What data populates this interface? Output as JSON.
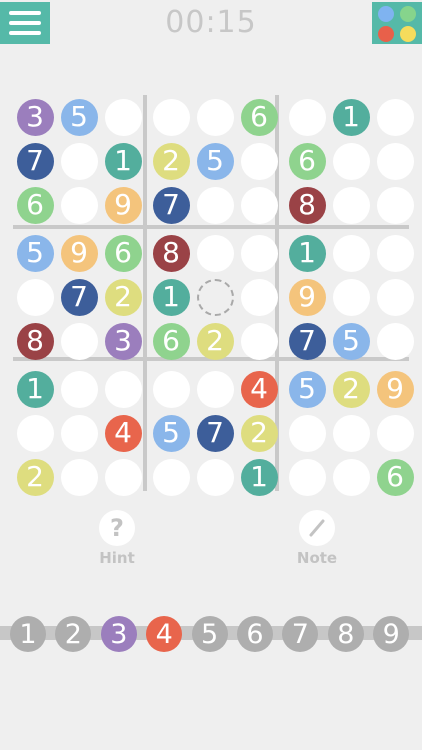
{
  "header": {
    "timer": "00:15",
    "menu_icon": "hamburger-icon",
    "palette_icon": "color-palette-icon",
    "palette_colors": [
      "#7fb3f0",
      "#86d48c",
      "#e8604a",
      "#f5dc5c"
    ]
  },
  "colors": {
    "1": "#53ae9d",
    "2": "#dedd7f",
    "3": "#9b7ebd",
    "4": "#e8654c",
    "5": "#8ab6ea",
    "6": "#8fd38e",
    "7": "#3d5e9a",
    "8": "#9a4246",
    "9": "#f4c47c"
  },
  "board": {
    "rows": [
      [
        "3",
        "5",
        "",
        "",
        "",
        "6",
        "",
        "1",
        ""
      ],
      [
        "7",
        "",
        "1",
        "2",
        "5",
        "",
        "6",
        "",
        ""
      ],
      [
        "6",
        "",
        "9",
        "7",
        "",
        "",
        "8",
        "",
        ""
      ],
      [
        "5",
        "9",
        "6",
        "8",
        "",
        "",
        "1",
        "",
        ""
      ],
      [
        "",
        "7",
        "2",
        "1",
        "",
        "",
        "9",
        "",
        ""
      ],
      [
        "8",
        "",
        "3",
        "6",
        "2",
        "",
        "7",
        "5",
        ""
      ],
      [
        "1",
        "",
        "",
        "",
        "",
        "4",
        "5",
        "2",
        "9"
      ],
      [
        "",
        "",
        "4",
        "5",
        "7",
        "2",
        "",
        "",
        ""
      ],
      [
        "2",
        "",
        "",
        "",
        "",
        "1",
        "",
        "",
        "6"
      ]
    ],
    "selected": {
      "row": 4,
      "col": 4
    }
  },
  "tools": {
    "hint": {
      "label": "Hint",
      "icon": "question-mark-icon",
      "glyph": "?"
    },
    "note": {
      "label": "Note",
      "icon": "pencil-icon"
    }
  },
  "number_bar": {
    "digits": [
      "1",
      "2",
      "3",
      "4",
      "5",
      "6",
      "7",
      "8",
      "9"
    ],
    "active_color": {
      "3": "#9b7ebd",
      "4": "#e8654c"
    },
    "inactive_color": "#aeaeae"
  }
}
